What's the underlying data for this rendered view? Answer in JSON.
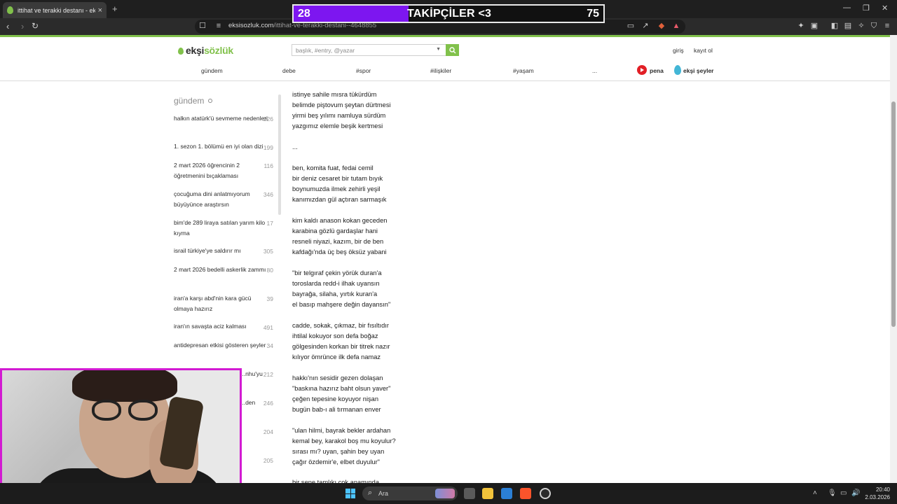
{
  "browser": {
    "tab_title": "ittihat ve terakki destanı - ekşi sözlük",
    "tab_close": "×",
    "new_tab": "+",
    "url_domain": "eksisozluk.com",
    "url_path": "/ittihat-ve-terakki-destani--4648855",
    "window_controls": [
      "—",
      "❐",
      "✕"
    ]
  },
  "overlay": {
    "left_value": "28",
    "label": "TAKİPÇİLER <3",
    "right_value": "75",
    "progress_fraction": 0.37,
    "fill_color": "#7d16f0"
  },
  "site": {
    "logo_part1": "ekşi",
    "logo_part2": "sözlük",
    "search_placeholder": "başlık, #entry, @yazar",
    "login": "giriş",
    "register": "kayıt ol",
    "accent_color": "#81c14b",
    "nav": [
      "gündem",
      "debe",
      "#spor",
      "#ilişkiler",
      "#yaşam",
      "..."
    ],
    "pena": "pena",
    "eksi_seyler": "ekşi şeyler"
  },
  "sidebar": {
    "title": "gündem",
    "topics": [
      {
        "title": "halkın atatürk'ü sevmeme nedenleri",
        "count": "226"
      },
      {
        "title": "1. sezon 1. bölümü en iyi olan dizi",
        "count": "199"
      },
      {
        "title": "2 mart 2026 öğrencinin 2 öğretmenini bıçaklaması",
        "count": "116"
      },
      {
        "title": "çocuğuma dini anlatmıyorum büyüyünce araştırsın",
        "count": "346"
      },
      {
        "title": "bim'de 289 liraya satılan yarım kilo kıyma",
        "count": "17"
      },
      {
        "title": "israil türkiye'ye saldırır mı",
        "count": "305"
      },
      {
        "title": "2 mart 2026 bedelli askerlik zammı",
        "count": "80"
      },
      {
        "title": "iran'a karşı abd'nin kara gücü olmaya hazırız",
        "count": "39"
      },
      {
        "title": "iran'ın savaşta aciz kalması",
        "count": "491"
      },
      {
        "title": "antidepresan etkisi gösteren şeyler",
        "count": "34"
      },
      {
        "title": "...nhu'yu",
        "count": "212"
      },
      {
        "title": "...den",
        "count": "246"
      },
      {
        "title": "",
        "count": "204"
      },
      {
        "title": "",
        "count": "205"
      }
    ]
  },
  "entry": {
    "lines": [
      "istinye sahile mısra tükürdüm",
      "belimde piştovum şeytan dürtmesi",
      "yirmi beş yılımı namluya sürdüm",
      "yazgımız elemle beşik kertmesi",
      "...",
      "ben, komita fuat, fedai cemil",
      "bir deniz cesaret bir tutam bıyık",
      "boynumuzda ilmek zehirli yeşil",
      "kanımızdan gül açtıran sarmaşık",
      "kim kaldı anason kokan geceden",
      "karabina gözlü gardaşlar hani",
      "resneli niyazi, kazım, bir de ben",
      "kafdağı'nda üç beş öksüz yabani",
      "\"bir telgıraf çekin yörük duran'a",
      "toroslarda redd-i ilhak uyansın",
      "bayrağa, silaha, yırtık kuran'a",
      "el basıp mahşere değin dayansın\"",
      "cadde, sokak, çıkmaz, bir fısıltıdır",
      "ihtilal kokuyor son defa boğaz",
      "gölgesinden korkan bir titrek nazır",
      "kılıyor ömrünce ilk defa namaz",
      "hakkı'nın sesidir gezen dolaşan",
      "\"baskına hazırız baht olsun yaver\"",
      "çeğen tepesine koyuyor nişan",
      "bugün bab-ı ali tırmanan enver",
      "\"ulan hilmi, bayrak bekler ardahan",
      "kemal bey, karakol boş mu koyulur?",
      "sırası mı? uyan, şahin bey uyan",
      "çağır özdemir'e, elbet duyulur\"",
      "bir sene tamlıkı çok anamında"
    ]
  },
  "taskbar": {
    "search_label": "Ara",
    "time": "20:40",
    "date": "2.03.2026"
  }
}
